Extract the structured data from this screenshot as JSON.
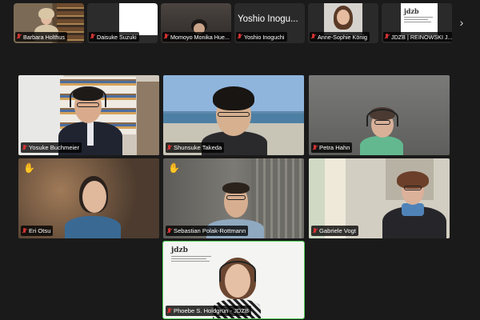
{
  "filmstrip": {
    "thumbs": [
      {
        "name": "Barbara Holthus"
      },
      {
        "name": "Daisuke Suzuki"
      },
      {
        "name": "Momoyo Monika Hue..."
      },
      {
        "name": "Yoshio Inoguchi",
        "tile_text": "Yoshio Inogu..."
      },
      {
        "name": "Anne-Sophie König"
      },
      {
        "name": "JDZB | REINOWSKI J..."
      }
    ],
    "next_icon": "›"
  },
  "grid": {
    "tiles": [
      {
        "name": "Yosuke Buchmeier",
        "raised_hand": false
      },
      {
        "name": "Shunsuke Takeda",
        "raised_hand": false
      },
      {
        "name": "Petra Hahn",
        "raised_hand": false
      },
      {
        "name": "Eri Otsu",
        "raised_hand": true
      },
      {
        "name": "Sebastian Polak-Rottmann",
        "raised_hand": true
      },
      {
        "name": "Gabriele Vogt",
        "raised_hand": false
      },
      {
        "name": "Phoebe S. Holdgrün - JDZB",
        "raised_hand": false,
        "active_speaker": true
      }
    ],
    "raised_hand_icon": "✋"
  },
  "logo": {
    "text": "jdzb"
  },
  "colors": {
    "muted_mic": "#d23333",
    "active_speaker_border": "#4ecf56",
    "background": "#1a1a1a"
  }
}
